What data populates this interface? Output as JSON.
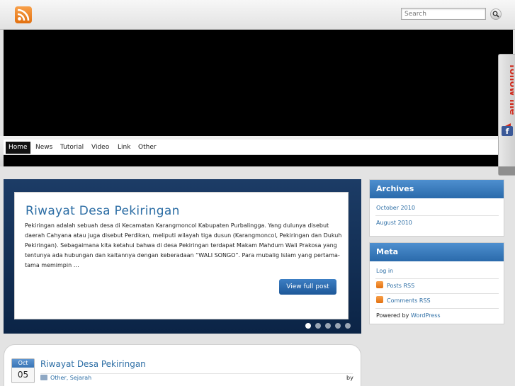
{
  "search": {
    "placeholder": "Search"
  },
  "nav": {
    "items": [
      "Home",
      "News",
      "Tutorial",
      "Video",
      "Link",
      "Other"
    ]
  },
  "follow": {
    "label": "follow me",
    "fb": "f"
  },
  "slider": {
    "title": "Riwayat Desa Pekiringan",
    "text": "Pekiringan adalah sebuah desa di Kecamatan Karangmoncol Kabupaten Purbalingga. Yang dulunya disebut daerah Cahyana atau juga disebut Perdikan, meliputi wilayah tiga dusun (Karangmoncol, Pekiringan dan Dukuh Pekiringan). Sebagaimana kita ketahui bahwa di desa Pekiringan terdapat Makam Mahdum Wali Prakosa yang tentunya ada hubungan dan kaitannya dengan keberadaan “WALI SONGO”. Para mubalig Islam yang pertama-tama memimpin …",
    "button": "View full post"
  },
  "post": {
    "month": "Oct",
    "day": "05",
    "title": "Riwayat Desa Pekiringan",
    "categories": "Other, Sejarah",
    "by": "by"
  },
  "archives": {
    "title": "Archives",
    "items": [
      "October 2010",
      "August 2010"
    ]
  },
  "meta": {
    "title": "Meta",
    "login": "Log in",
    "posts_rss": "Posts RSS",
    "comments_rss": "Comments RSS",
    "powered_prefix": "Powered by ",
    "powered_link": "WordPress"
  }
}
